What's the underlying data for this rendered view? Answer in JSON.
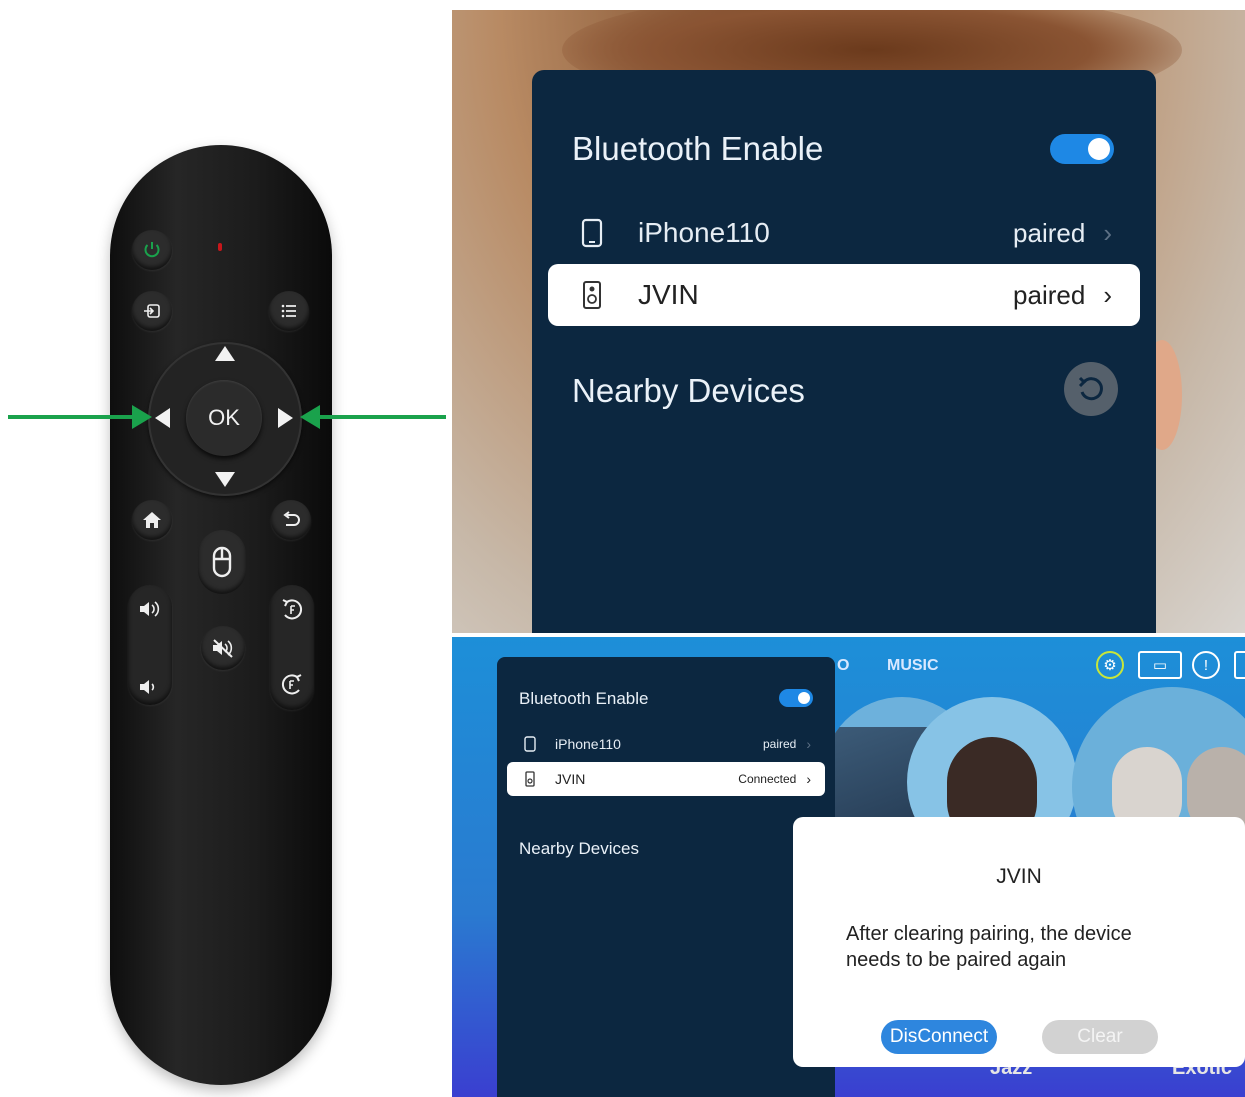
{
  "remote": {
    "ok_label": "OK",
    "icons": [
      "power-icon",
      "input-icon",
      "menu-icon",
      "home-icon",
      "back-icon",
      "mouse-icon",
      "volume-up-icon",
      "volume-down-icon",
      "mute-icon",
      "rewind-icon",
      "forward-icon"
    ],
    "arrow_color": "#1aa24c"
  },
  "top_screen": {
    "title": "Bluetooth Enable",
    "toggle_on": true,
    "devices": [
      {
        "name": "iPhone110",
        "status": "paired",
        "icon": "phone-icon",
        "selected": false
      },
      {
        "name": "JVIN",
        "status": "paired",
        "icon": "speaker-icon",
        "selected": true
      }
    ],
    "nearby_title": "Nearby Devices"
  },
  "bottom_screen": {
    "nav_letter": "O",
    "nav_music": "MUSIC",
    "title": "Bluetooth Enable",
    "toggle_on": true,
    "devices": [
      {
        "name": "iPhone110",
        "status": "paired",
        "icon": "phone-icon",
        "selected": false
      },
      {
        "name": "JVIN",
        "status": "Connected",
        "icon": "speaker-icon",
        "selected": true
      }
    ],
    "nearby_title": "Nearby Devices",
    "dialog": {
      "title": "JVIN",
      "message": "After clearing pairing, the device needs to be paired again",
      "disconnect_label": "DisConnect",
      "clear_label": "Clear"
    },
    "bottom_labels": [
      "Jazz",
      "Exotic"
    ]
  },
  "colors": {
    "panel_bg": "#0c2740",
    "toggle_on": "#1e88e5",
    "accent_blue": "#2e86de"
  }
}
